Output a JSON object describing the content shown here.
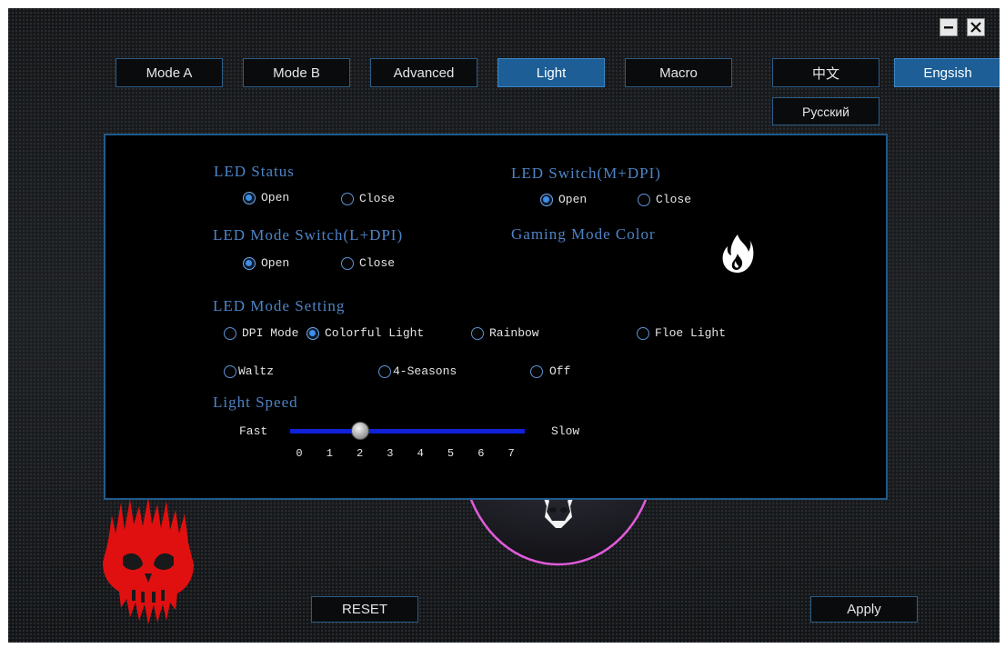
{
  "window": {
    "minimize_icon": "minimize-icon",
    "close_icon": "close-icon"
  },
  "tabs": [
    {
      "label": "Mode A",
      "active": false
    },
    {
      "label": "Mode B",
      "active": false
    },
    {
      "label": "Advanced",
      "active": false
    },
    {
      "label": "Light",
      "active": true
    },
    {
      "label": "Macro",
      "active": false
    }
  ],
  "languages": {
    "chinese": "中文",
    "english": "Engsish",
    "russian": "Русский",
    "selected": "english"
  },
  "led_status": {
    "title": "LED Status",
    "open": "Open",
    "close": "Close",
    "selected": "open"
  },
  "led_switch": {
    "title": "LED Switch(M+DPI)",
    "open": "Open",
    "close": "Close",
    "selected": "open"
  },
  "led_mode_switch": {
    "title": "LED Mode Switch(L+DPI)",
    "open": "Open",
    "close": "Close",
    "selected": "open"
  },
  "gaming_mode_color": {
    "title": "Gaming Mode Color",
    "icon": "flame-icon"
  },
  "led_mode_setting": {
    "title": "LED Mode Setting",
    "options": {
      "dpi_mode": "DPI Mode",
      "colorful_light": "Colorful Light",
      "rainbow": "Rainbow",
      "floe_light": "Floe Light",
      "waltz": "Waltz",
      "four_seasons": "4-Seasons",
      "off": "Off"
    },
    "selected": "colorful_light"
  },
  "light_speed": {
    "title": "Light Speed",
    "fast_label": "Fast",
    "slow_label": "Slow",
    "ticks": [
      "0",
      "1",
      "2",
      "3",
      "4",
      "5",
      "6",
      "7"
    ],
    "value": 2,
    "min": 0,
    "max": 7
  },
  "decor": {
    "logo_icon": "red-skull-logo",
    "device_icon": "skull-mouse-icon",
    "accent_color": "#1d5e96",
    "title_color": "#4e84c6",
    "slider_color": "#1021d8",
    "logo_color": "#e01010"
  },
  "buttons": {
    "reset": "RESET",
    "apply": "Apply"
  }
}
